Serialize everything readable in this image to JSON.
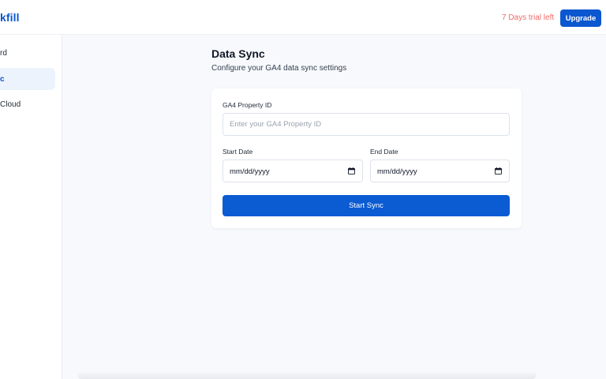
{
  "header": {
    "logo_text": "kfill",
    "trial_text": "7 Days trial left",
    "upgrade_label": "Upgrade"
  },
  "sidebar": {
    "items": [
      {
        "label": "rd",
        "active": false
      },
      {
        "label": "c",
        "active": true
      },
      {
        "label": "Cloud",
        "active": false
      }
    ]
  },
  "main": {
    "title": "Data Sync",
    "subtitle": "Configure your GA4 data sync settings",
    "form": {
      "property_label": "GA4 Property ID",
      "property_placeholder": "Enter your GA4 Property ID",
      "property_value": "",
      "start_label": "Start Date",
      "start_value": "mm/dd/yyyy",
      "end_label": "End Date",
      "end_value": "mm/dd/yyyy",
      "submit_label": "Start Sync"
    }
  },
  "colors": {
    "brand": "#0b57d0",
    "trial": "#f26a6a",
    "background": "#f7f9fc"
  },
  "icons": {
    "date_picker": "calendar-icon"
  }
}
